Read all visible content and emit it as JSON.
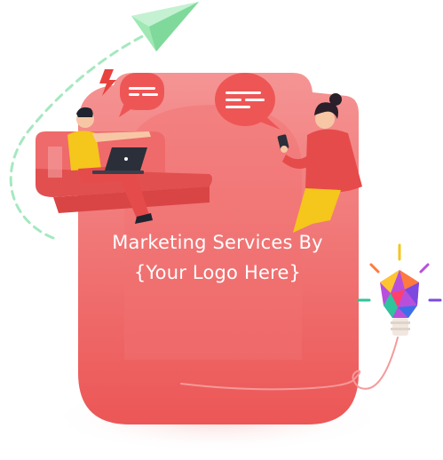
{
  "headline": {
    "line1": "Marketing Services By",
    "line2": "{Your Logo Here}"
  },
  "colors": {
    "card_top": "#f48f8f",
    "card_bottom": "#ee5a5a",
    "shirt_red": "#e64b4b",
    "shirt_yellow": "#f5c61b",
    "paper_plane": "#8fe3a8",
    "dashed_path": "#a6e8c0",
    "lightning": "#e8423f"
  },
  "icons": [
    "paper-plane-icon",
    "chat-bubble-icon",
    "lightning-icon",
    "lightbulb-icon",
    "laptop-icon",
    "smartphone-icon"
  ]
}
